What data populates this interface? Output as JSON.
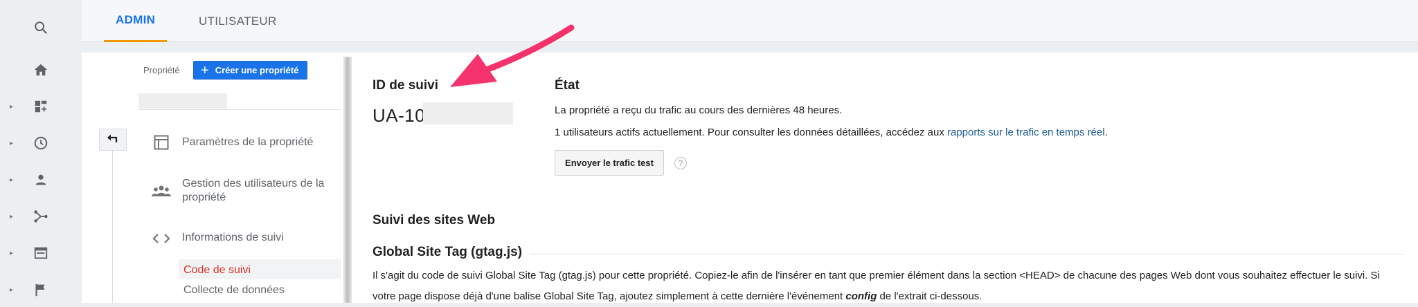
{
  "tabs": {
    "admin": "ADMIN",
    "user": "UTILISATEUR"
  },
  "rail": {
    "items": [
      {
        "icon": "search-icon"
      },
      {
        "icon": "home-icon"
      },
      {
        "icon": "dashboard-icon"
      },
      {
        "icon": "clock-icon"
      },
      {
        "icon": "person-icon"
      },
      {
        "icon": "acquisition-icon"
      },
      {
        "icon": "behavior-icon"
      },
      {
        "icon": "flag-icon"
      }
    ]
  },
  "property": {
    "label": "Propriété",
    "create_button": "Créer une propriété",
    "create_icon": "plus-icon"
  },
  "nav": {
    "settings": "Paramètres de la propriété",
    "users_line1": "Gestion des utilisateurs de la",
    "users_line2": "propriété",
    "tracking": "Informations de suivi",
    "sub_code": "Code de suivi",
    "sub_collect": "Collecte de données"
  },
  "tracking_id": {
    "heading": "ID de suivi",
    "value": "UA-10"
  },
  "status": {
    "heading": "État",
    "line1": "La propriété a reçu du trafic au cours des dernières 48 heures.",
    "line2_prefix": "1 utilisateurs actifs actuellement. Pour consulter les données détaillées, accédez aux ",
    "line2_link": "rapports sur le trafic en temps réel",
    "line2_suffix": ".",
    "send_button": "Envoyer le trafic test",
    "help": "?"
  },
  "websites": {
    "heading": "Suivi des sites Web",
    "gtag_heading": "Global Site Tag (gtag.js)",
    "desc_part1": "Il s'agit du code de suivi Global Site Tag (gtag.js) pour cette propriété. Copiez-le afin de l'insérer en tant que premier élément dans la section <HEAD> de chacune des pages Web dont vous souhaitez effectuer le suivi. Si votre page dispose déjà d'une balise Global Site Tag, ajoutez simplement à cette dernière l'événement ",
    "desc_em": "config",
    "desc_part2": " de l'extrait ci-dessous."
  },
  "colors": {
    "accent": "#1a73e8",
    "tab_underline": "#f29900",
    "arrow": "#f4336e",
    "active_sub": "#d93025"
  }
}
